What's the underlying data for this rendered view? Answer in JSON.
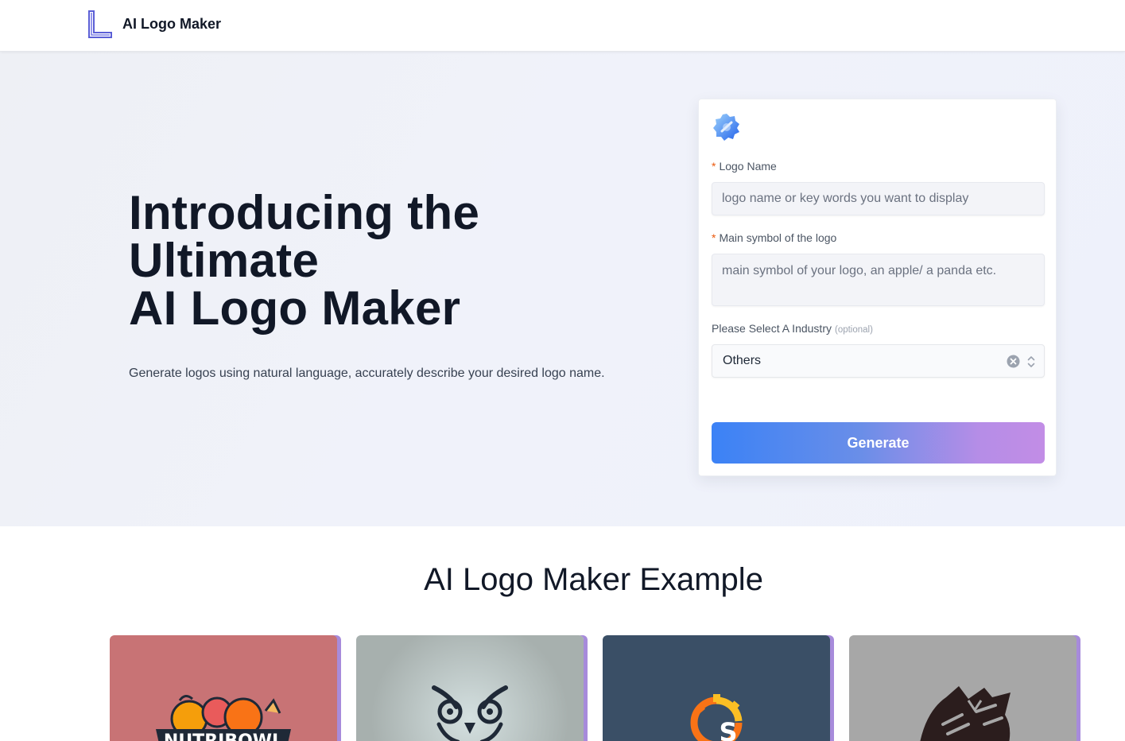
{
  "header": {
    "brand_name": "AI Logo Maker",
    "brand_logo_icon": "letter-l-logo-icon"
  },
  "hero": {
    "title_lines": [
      "Introducing the",
      "Ultimate",
      "AI Logo Maker"
    ],
    "subtitle": "Generate logos using natural language, accurately describe your desired logo name."
  },
  "form": {
    "badge_icon": "blue-gear-icon",
    "logo_name": {
      "required_mark": "*",
      "label": "Logo Name",
      "placeholder": "logo name or key words you want to display",
      "value": ""
    },
    "main_symbol": {
      "required_mark": "*",
      "label": "Main symbol of the logo",
      "placeholder": "main symbol of your logo, an apple/ a panda etc.",
      "value": ""
    },
    "industry": {
      "label": "Please Select A Industry",
      "optional_note": "(optional)",
      "selected": "Others"
    },
    "generate_label": "Generate"
  },
  "examples": {
    "title": "AI Logo Maker Example",
    "cards": [
      {
        "bg": "#c87375",
        "icon": "fruit-bowl-logo",
        "text": "NUTRIBOWL"
      },
      {
        "bg": "#a9b3b1",
        "icon": "owl-logo"
      },
      {
        "bg": "#3a4f66",
        "icon": "gear-s-logo",
        "text": "S"
      },
      {
        "bg": "#a7a7a7",
        "icon": "tiger-head-logo"
      }
    ]
  },
  "colors": {
    "accent_start": "#3b82f6",
    "accent_end": "#c28de6",
    "required": "#ea580c",
    "card_edge": "#a78bdb"
  }
}
